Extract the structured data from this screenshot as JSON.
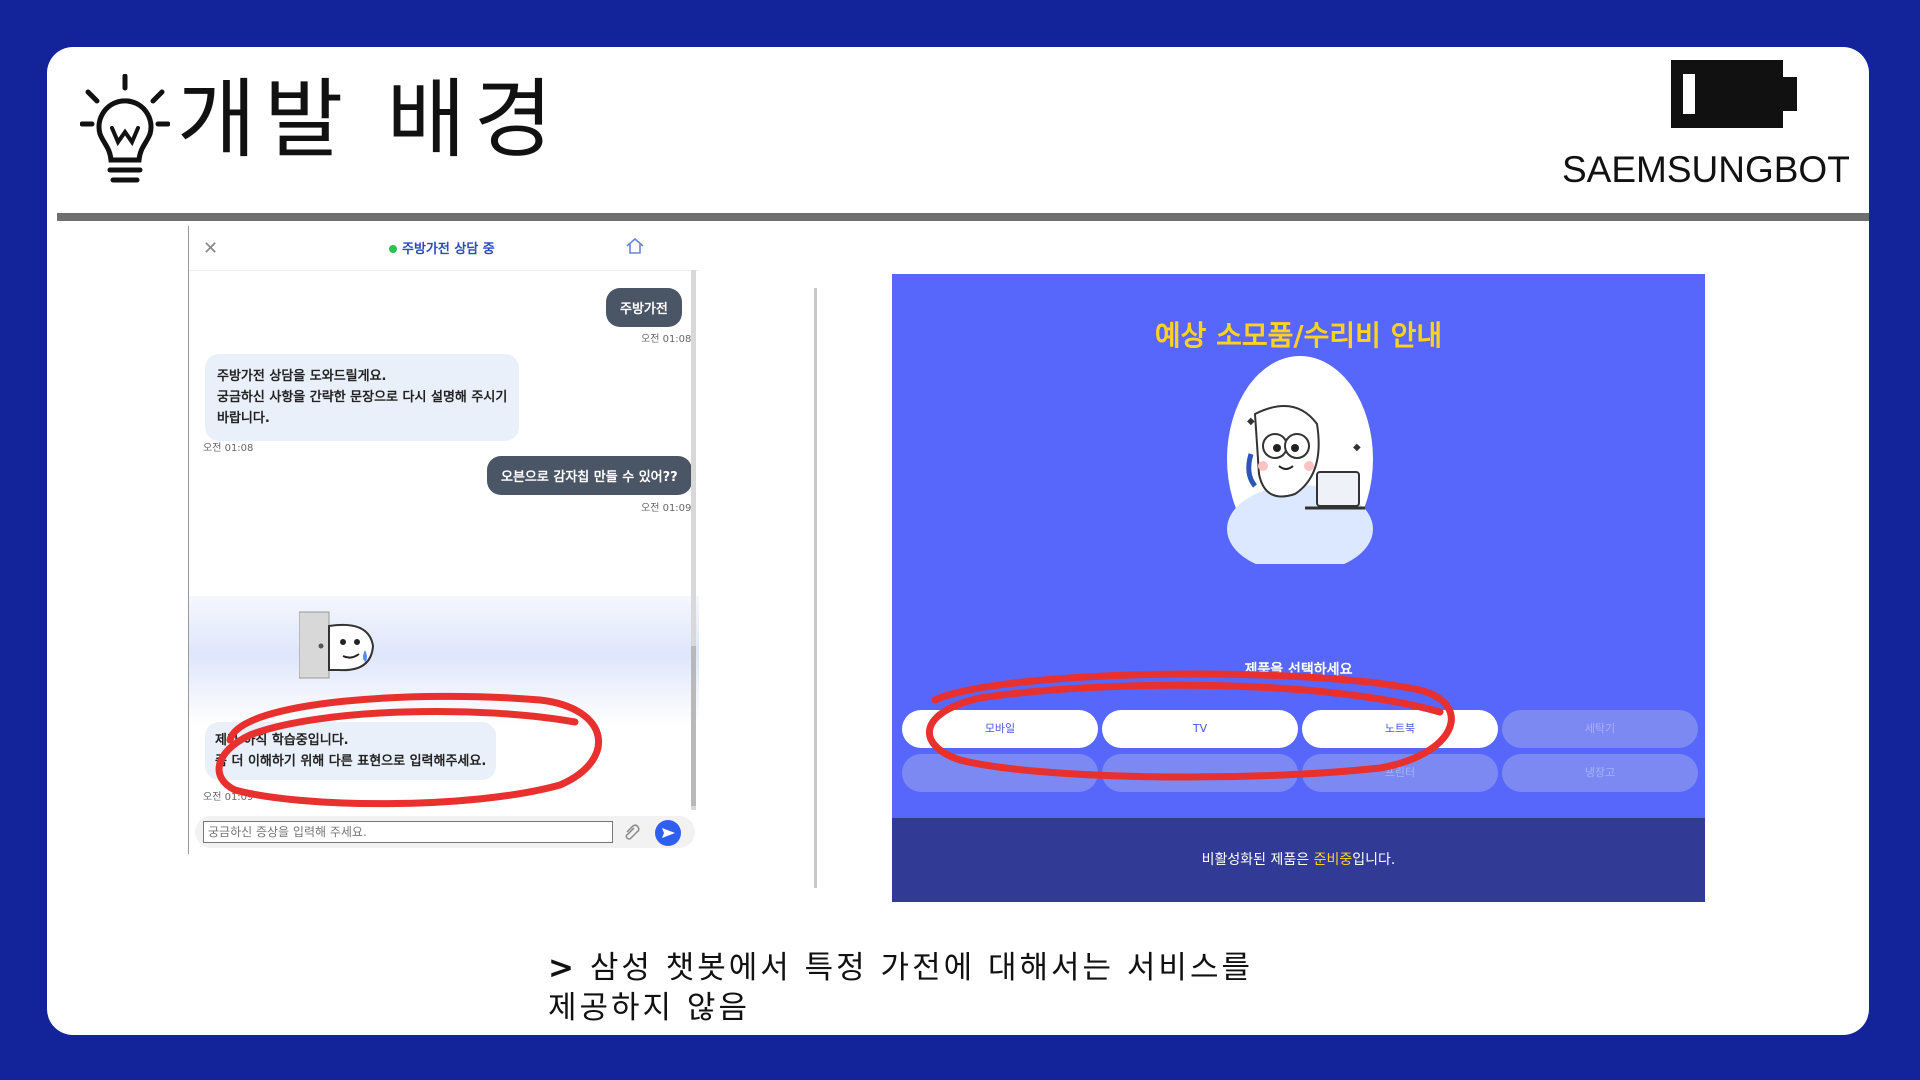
{
  "slide": {
    "title": "개발 배경",
    "brand": "SAEMSUNGBOT"
  },
  "chat": {
    "status": "주방가전 상담 중",
    "input_placeholder": "궁금하신 증상을 입력해 주세요.",
    "messages": [
      {
        "from": "user",
        "text": "주방가전",
        "time": "오전 01:08"
      },
      {
        "from": "bot",
        "lines": [
          "주방가전 상담을 도와드릴게요.",
          "궁금하신 사항을 간략한 문장으로 다시 설명해 주시기",
          "바랍니다."
        ],
        "time": "오전 01:08"
      },
      {
        "from": "user",
        "text": "오븐으로 감자칩 만들 수 있어??",
        "time": "오전 01:09"
      },
      {
        "from": "bot",
        "lines": [
          "제가 아직 학습중입니다.",
          "좀 더 이해하기 위해 다른 표현으로 입력해주세요."
        ],
        "time": "오전 01:09"
      }
    ]
  },
  "shop": {
    "title": "예상 소모품/수리비 안내",
    "prompt": "제품을 선택하세요",
    "products_row1": [
      {
        "label": "모바일",
        "active": true
      },
      {
        "label": "TV",
        "active": true
      },
      {
        "label": "노트북",
        "active": true
      },
      {
        "label": "세탁기",
        "active": false
      }
    ],
    "products_row2": [
      {
        "label": "",
        "active": false
      },
      {
        "label": "",
        "active": false
      },
      {
        "label": "프린터",
        "active": false
      },
      {
        "label": "냉장고",
        "active": false
      }
    ],
    "footer_prefix": "비활성화된 제품은 ",
    "footer_highlight": "준비중",
    "footer_suffix": "입니다."
  },
  "caption": {
    "marker": ">",
    "line1": " 삼성 챗봇에서 특정 가전에 대해서는 서비스를",
    "line2": "제공하지 않음"
  },
  "colors": {
    "background": "#13249a",
    "highlight_circle": "#e8302e",
    "shop_bg": "#5867fb",
    "shop_title": "#ffd21c"
  },
  "icons": [
    "lightbulb-icon",
    "battery-icon",
    "close-icon",
    "home-icon",
    "attach-icon",
    "send-icon"
  ]
}
